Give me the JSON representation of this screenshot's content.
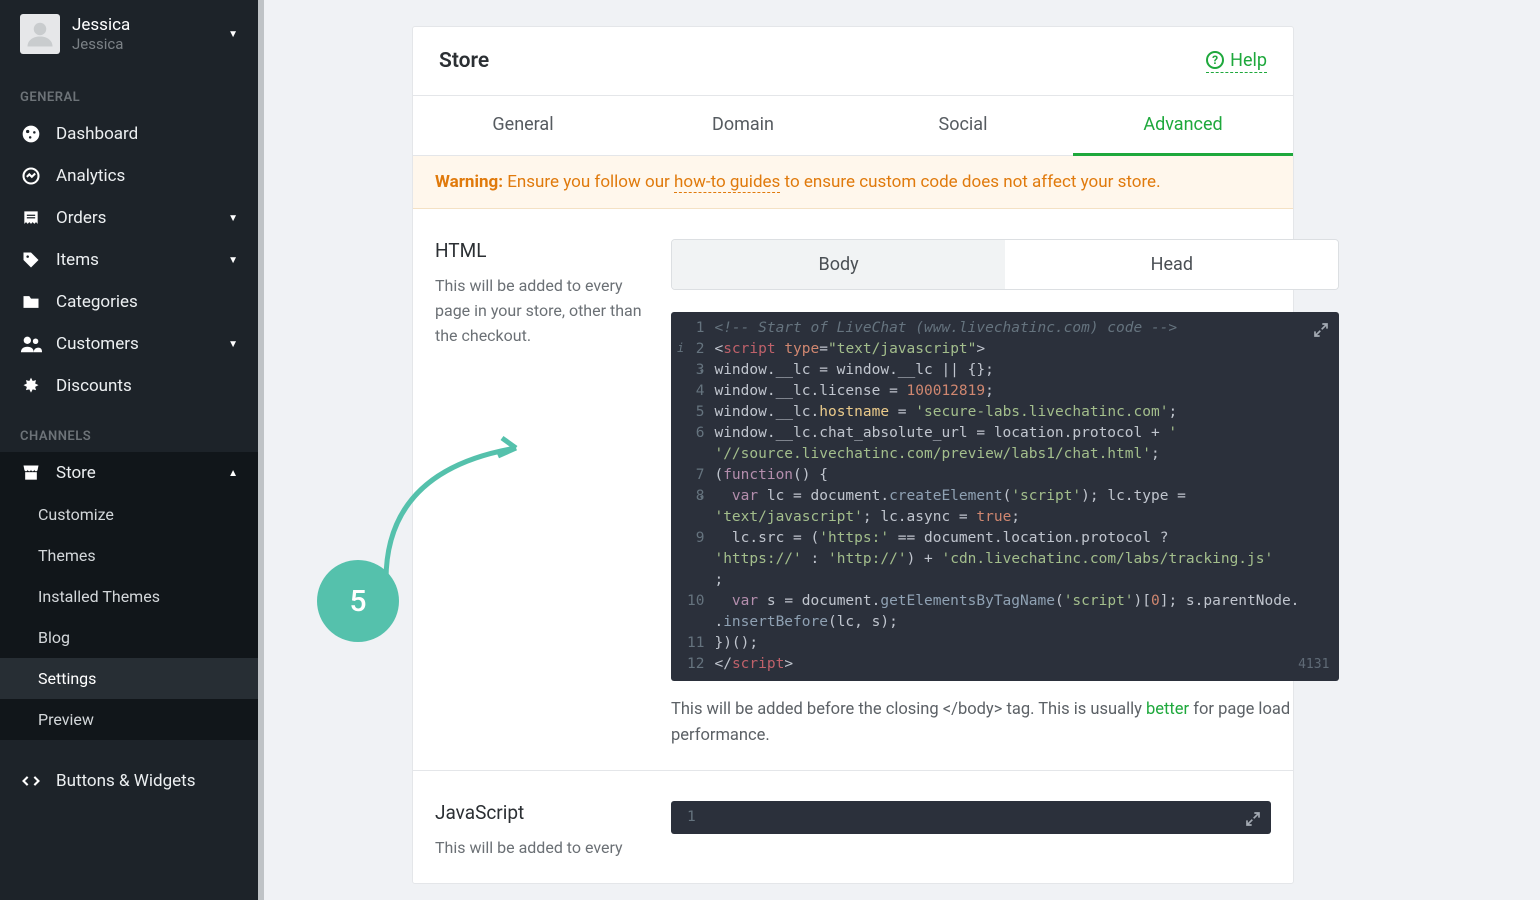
{
  "user": {
    "primary": "Jessica",
    "secondary": "Jessica"
  },
  "sidebar": {
    "general_label": "GENERAL",
    "channels_label": "CHANNELS",
    "general": [
      {
        "label": "Dashboard",
        "icon": "dashboard",
        "expandable": false
      },
      {
        "label": "Analytics",
        "icon": "analytics",
        "expandable": false
      },
      {
        "label": "Orders",
        "icon": "orders",
        "expandable": true
      },
      {
        "label": "Items",
        "icon": "items",
        "expandable": true
      },
      {
        "label": "Categories",
        "icon": "categories",
        "expandable": false
      },
      {
        "label": "Customers",
        "icon": "customers",
        "expandable": true
      },
      {
        "label": "Discounts",
        "icon": "discounts",
        "expandable": false
      }
    ],
    "store_label": "Store",
    "store_items": [
      {
        "label": "Customize",
        "active": false
      },
      {
        "label": "Themes",
        "active": false
      },
      {
        "label": "Installed Themes",
        "active": false
      },
      {
        "label": "Blog",
        "active": false
      },
      {
        "label": "Settings",
        "active": true
      },
      {
        "label": "Preview",
        "active": false
      }
    ],
    "buttons_widgets": "Buttons & Widgets"
  },
  "panel": {
    "title": "Store",
    "help": "Help",
    "tabs": [
      "General",
      "Domain",
      "Social",
      "Advanced"
    ],
    "active_tab": 3,
    "warning_prefix": "Warning:",
    "warning_text_a": " Ensure you follow our ",
    "warning_link": "how-to guides",
    "warning_text_b": " to ensure custom code does not affect your store."
  },
  "html_section": {
    "title": "HTML",
    "desc": "This will be added to every page in your store, other than the checkout.",
    "toggle": [
      "Body",
      "Head"
    ],
    "active_toggle": 0,
    "char_count": "4131",
    "hint_a": "This will be added before the closing </body> tag. This is usually ",
    "hint_better": "better",
    "hint_b": " for page load performance.",
    "code_numbers": [
      "1",
      "2",
      "3",
      "4",
      "5",
      "6",
      "",
      "7",
      "8",
      "",
      "9",
      "",
      "",
      "10",
      "",
      "11",
      "12"
    ]
  },
  "js_section": {
    "title": "JavaScript",
    "desc": "This will be added to every"
  },
  "annotation": {
    "number": "5"
  },
  "code": {
    "l1": "<!-- Start of LiveChat (www.livechatinc.com) code -->",
    "l2a": "<",
    "l2b": "script",
    "l2c": " type",
    "l2d": "=",
    "l2e": "\"text/javascript\"",
    "l2f": ">",
    "l3": "window.__lc = window.__lc || {};",
    "l4a": "window.__lc.license = ",
    "l4b": "100012819",
    "l4c": ";",
    "l5a": "window.__lc.",
    "l5b": "hostname",
    "l5c": " = ",
    "l5d": "'secure-labs.livechatinc.com'",
    "l5e": ";",
    "l6a": "window.__lc.chat_absolute_url = location.protocol + ",
    "l6b": "'//source.livechatinc.com/preview/labs1/chat.html'",
    "l6c": ";",
    "l7a": "(",
    "l7b": "function",
    "l7c": "() {",
    "l8a": "  var",
    "l8b": " lc = document.",
    "l8c": "createElement",
    "l8d": "(",
    "l8e": "'script'",
    "l8f": "); lc.type = ",
    "l8g": "'text/javascript'",
    "l8h": "; lc.async = ",
    "l8i": "true",
    "l8j": ";",
    "l9a": "  lc.src = (",
    "l9b": "'https:'",
    "l9c": " == document.location.protocol ? ",
    "l9d": "'https://'",
    "l9e": " : ",
    "l9f": "'http://'",
    "l9g": ") + ",
    "l9h": "'cdn.livechatinc.com/labs/tracking.js'",
    "l9i": ";",
    "l10a": "  var",
    "l10b": " s = document.",
    "l10c": "getElementsByTagName",
    "l10d": "(",
    "l10e": "'script'",
    "l10f": ")[",
    "l10g": "0",
    "l10h": "]; s.parentNode.",
    "l10i": "insertBefore",
    "l10j": "(lc, s);",
    "l11": "})();",
    "l12a": "</",
    "l12b": "script",
    "l12c": ">"
  }
}
